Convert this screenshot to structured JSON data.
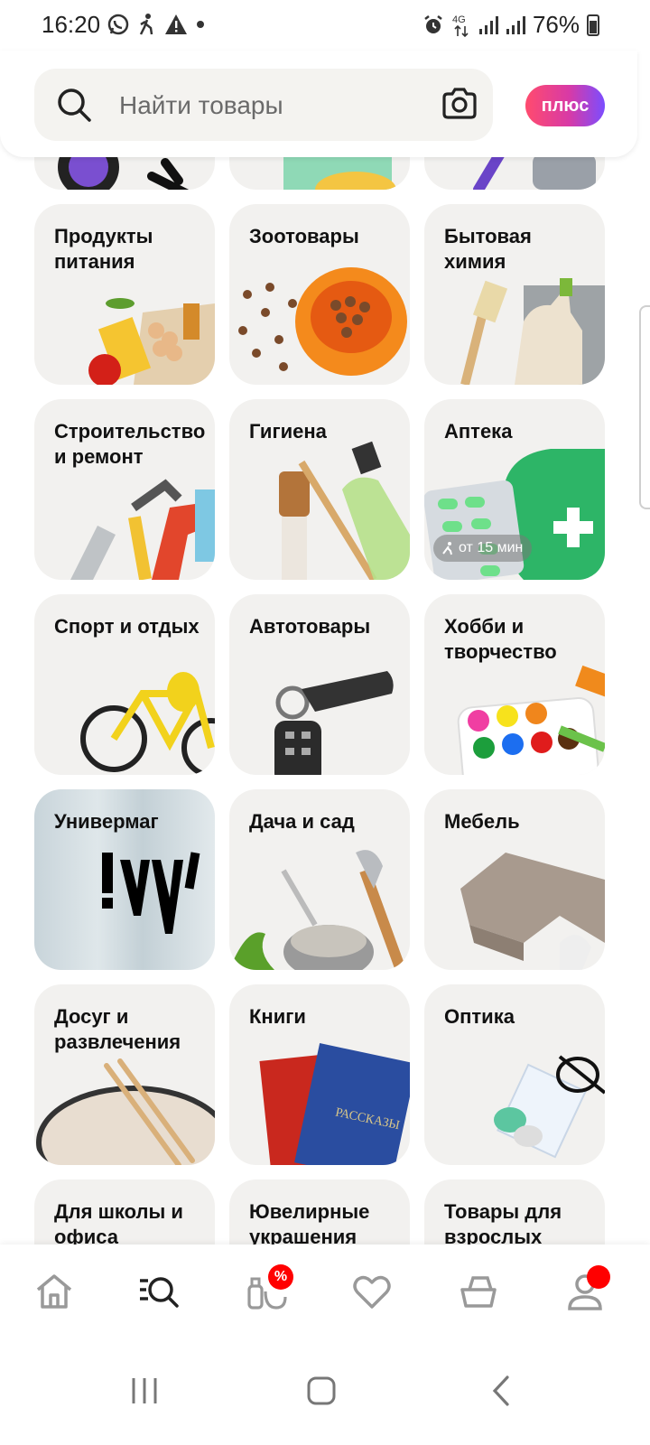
{
  "status_bar": {
    "time": "16:20",
    "battery": "76%",
    "network": "4G"
  },
  "search": {
    "placeholder": "Найти товары"
  },
  "plus_badge": "плюс",
  "categories": [
    {
      "label": "Продукты питания"
    },
    {
      "label": "Зоотовары"
    },
    {
      "label": "Бытовая химия"
    },
    {
      "label": "Строительство и ремонт"
    },
    {
      "label": "Гигиена"
    },
    {
      "label": "Аптека",
      "badge": "от 15 мин"
    },
    {
      "label": "Спорт и отдых"
    },
    {
      "label": "Автотовары"
    },
    {
      "label": "Хобби и творчество"
    },
    {
      "label": "Универмаг"
    },
    {
      "label": "Дача и сад"
    },
    {
      "label": "Мебель"
    },
    {
      "label": "Досуг и развлечения"
    },
    {
      "label": "Книги"
    },
    {
      "label": "Оптика"
    },
    {
      "label": "Для школы и офиса"
    },
    {
      "label": "Ювелирные украшения"
    },
    {
      "label": "Товары для взрослых"
    }
  ],
  "univermag_logo_text": "!УУ'",
  "book_cover_text": "РАССКАЗЫ",
  "nav": {
    "discount_badge": "%",
    "items": [
      "home-icon",
      "catalog-icon",
      "discounts-icon",
      "favorites-icon",
      "cart-icon",
      "profile-icon"
    ]
  },
  "colors": {
    "card_bg": "#f2f1ef",
    "badge_red": "#ff0000",
    "plus_gradient_start": "#ff4b6e",
    "plus_gradient_end": "#7b4dff"
  }
}
